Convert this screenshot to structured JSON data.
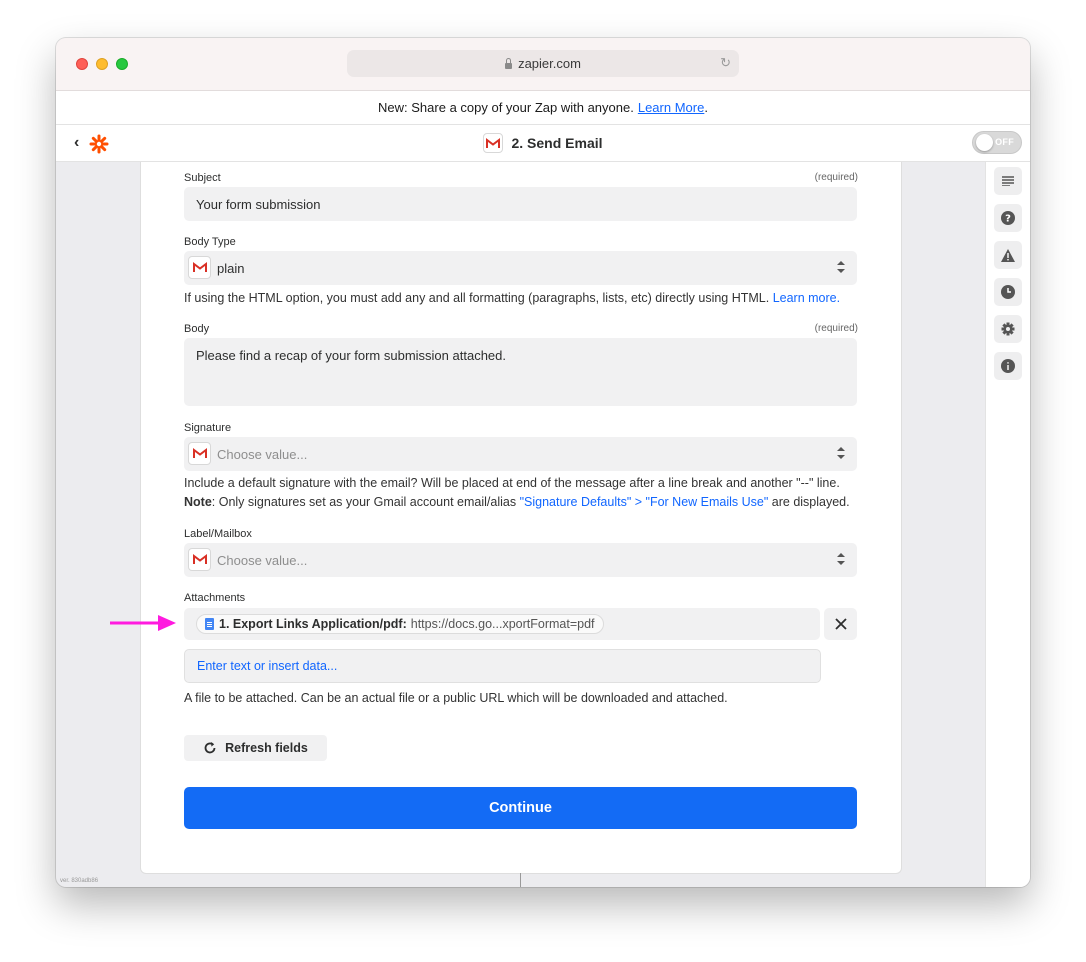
{
  "browser": {
    "url": "zapier.com"
  },
  "announcement": {
    "text": "New: Share a copy of your Zap with anyone.",
    "link": "Learn More",
    "period": "."
  },
  "header": {
    "title": "2. Send Email",
    "toggle_label": "OFF"
  },
  "fields": {
    "subject": {
      "label": "Subject",
      "required": "(required)",
      "value": "Your form submission"
    },
    "body_type": {
      "label": "Body Type",
      "value": "plain",
      "help": "If using the HTML option, you must add any and all formatting (paragraphs, lists, etc) directly using HTML.",
      "help_link": "Learn more."
    },
    "body": {
      "label": "Body",
      "required": "(required)",
      "value": "Please find a recap of your form submission attached."
    },
    "signature": {
      "label": "Signature",
      "placeholder": "Choose value...",
      "help_line1": "Include a default signature with the email? Will be placed at end of the message after a line break and another \"--\" line.",
      "note_label": "Note",
      "help_line2_pre": ": Only signatures set as your Gmail account email/alias ",
      "help_line2_link": "\"Signature Defaults\" > \"For New Emails Use\"",
      "help_line2_post": " are displayed."
    },
    "label_mailbox": {
      "label": "Label/Mailbox",
      "placeholder": "Choose value..."
    },
    "attachments": {
      "label": "Attachments",
      "chip_step": "1. Export Links Application/pdf:",
      "chip_value": "https://docs.go...xportFormat=pdf",
      "enter_placeholder": "Enter text or insert data...",
      "help": "A file to be attached. Can be an actual file or a public URL which will be downloaded and attached."
    }
  },
  "buttons": {
    "refresh": "Refresh fields",
    "continue": "Continue"
  },
  "version": "ver. 830adb86",
  "colors": {
    "accent": "#136bf5",
    "zapier_orange": "#ff4f00",
    "annotation_arrow": "#ff1adf"
  },
  "sidebar_icons": [
    "details-icon",
    "help-icon",
    "warning-icon",
    "history-icon",
    "settings-icon",
    "info-icon"
  ]
}
